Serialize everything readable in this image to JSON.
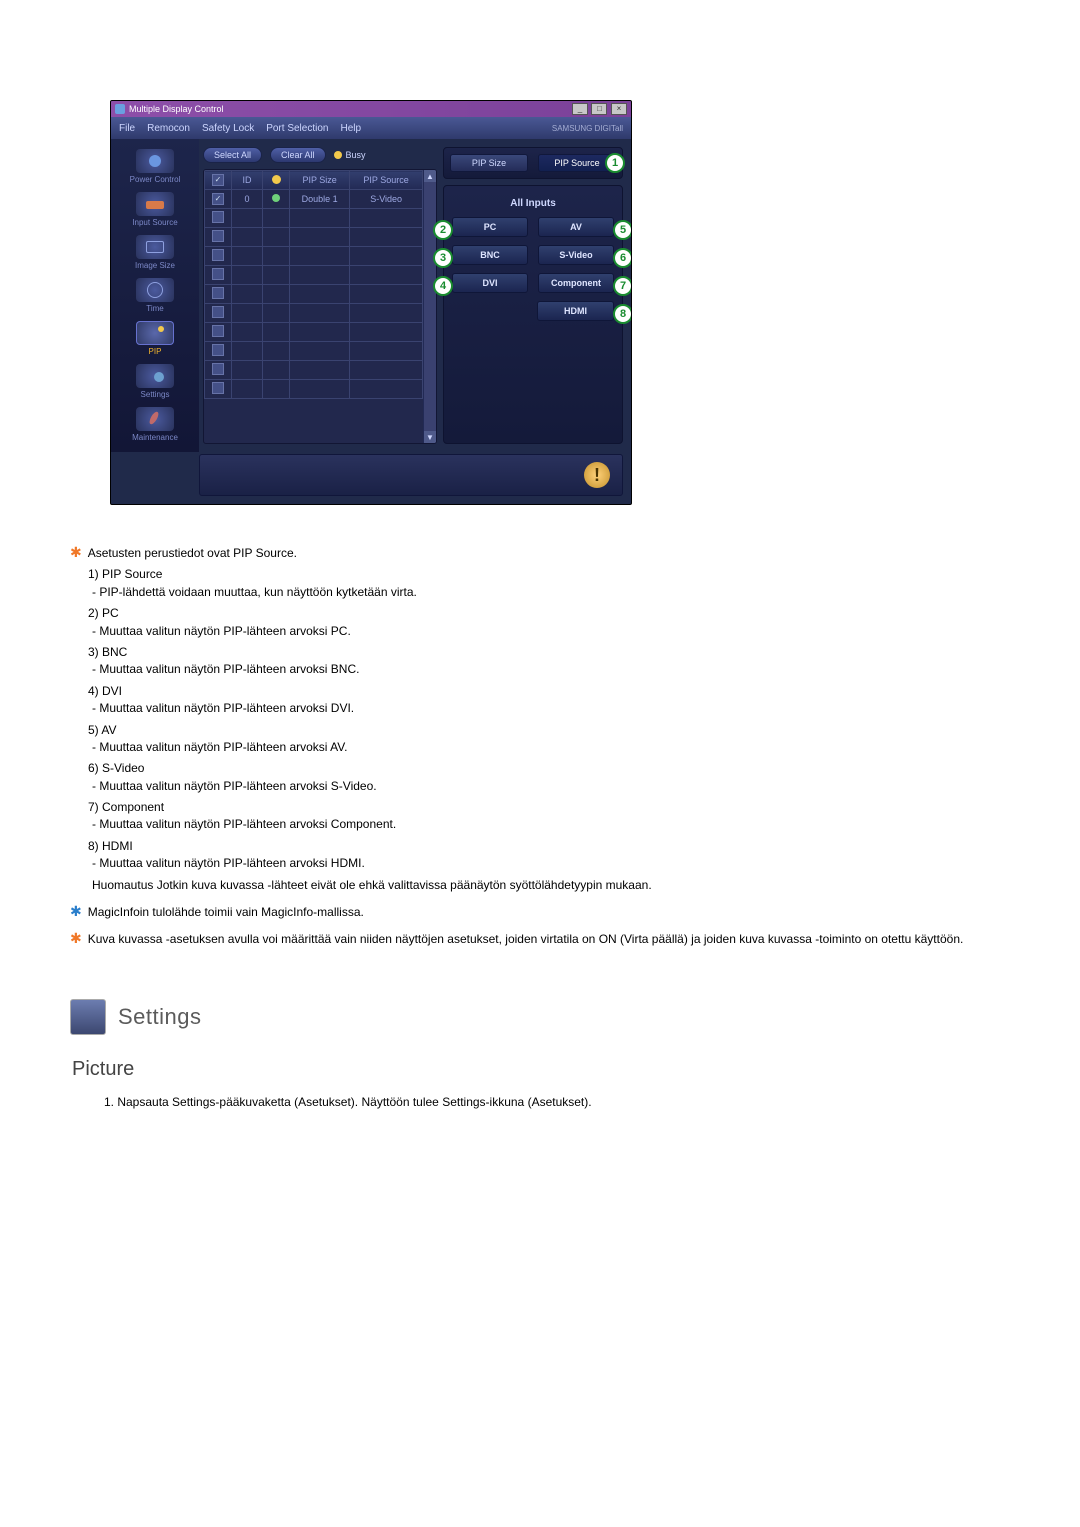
{
  "window": {
    "title": "Multiple Display Control",
    "brand": "SAMSUNG DIGITall"
  },
  "menu": [
    "File",
    "Remocon",
    "Safety Lock",
    "Port Selection",
    "Help"
  ],
  "sidebar": [
    {
      "label": "Power Control"
    },
    {
      "label": "Input Source"
    },
    {
      "label": "Image Size"
    },
    {
      "label": "Time"
    },
    {
      "label": "PIP"
    },
    {
      "label": "Settings"
    },
    {
      "label": "Maintenance"
    }
  ],
  "buttons": {
    "select_all": "Select All",
    "clear_all": "Clear All",
    "busy": "Busy"
  },
  "grid": {
    "headers": [
      "",
      "ID",
      "",
      "PIP Size",
      "PIP Source"
    ],
    "row": {
      "id": "0",
      "pip_size": "Double 1",
      "pip_source": "S-Video"
    }
  },
  "right": {
    "seg": {
      "pip_size": "PIP Size",
      "pip_source": "PIP Source"
    },
    "inputs_header": "All Inputs",
    "rows": [
      {
        "left": "PC",
        "leftnum": "2",
        "right": "AV",
        "rightnum": "5"
      },
      {
        "left": "BNC",
        "leftnum": "3",
        "right": "S-Video",
        "rightnum": "6"
      },
      {
        "left": "DVI",
        "leftnum": "4",
        "right": "Component",
        "rightnum": "7"
      },
      {
        "left": "",
        "leftnum": "",
        "right": "HDMI",
        "rightnum": "8"
      }
    ],
    "source_num": "1"
  },
  "doc": {
    "star1": "Asetusten perustiedot ovat PIP Source.",
    "items": [
      {
        "t": "1)  PIP Source",
        "d": "- PIP-lähdettä voidaan muuttaa, kun näyttöön kytketään virta."
      },
      {
        "t": "2)  PC",
        "d": "- Muuttaa valitun näytön PIP-lähteen arvoksi PC."
      },
      {
        "t": "3)  BNC",
        "d": "- Muuttaa valitun näytön PIP-lähteen arvoksi BNC."
      },
      {
        "t": "4)  DVI",
        "d": "- Muuttaa valitun näytön PIP-lähteen arvoksi DVI."
      },
      {
        "t": "5)  AV",
        "d": "- Muuttaa valitun näytön PIP-lähteen arvoksi AV."
      },
      {
        "t": "6)  S-Video",
        "d": "- Muuttaa valitun näytön PIP-lähteen arvoksi S-Video."
      },
      {
        "t": "7)  Component",
        "d": "- Muuttaa valitun näytön PIP-lähteen arvoksi Component."
      },
      {
        "t": "8)  HDMI",
        "d": "- Muuttaa valitun näytön PIP-lähteen arvoksi HDMI."
      }
    ],
    "note": "Huomautus Jotkin kuva kuvassa -lähteet eivät ole ehkä valittavissa päänäytön syöttölähdetyypin mukaan.",
    "star_blue": "MagicInfoin tulolähde toimii vain MagicInfo-mallissa.",
    "star2": "Kuva kuvassa -asetuksen avulla voi määrittää vain niiden näyttöjen asetukset, joiden virtatila on ON (Virta päällä) ja joiden kuva kuvassa -toiminto on otettu käyttöön.",
    "settings_hdr": "Settings",
    "picture_hdr": "Picture",
    "step1": "1.  Napsauta Settings-pääkuvaketta (Asetukset). Näyttöön tulee Settings-ikkuna (Asetukset)."
  }
}
